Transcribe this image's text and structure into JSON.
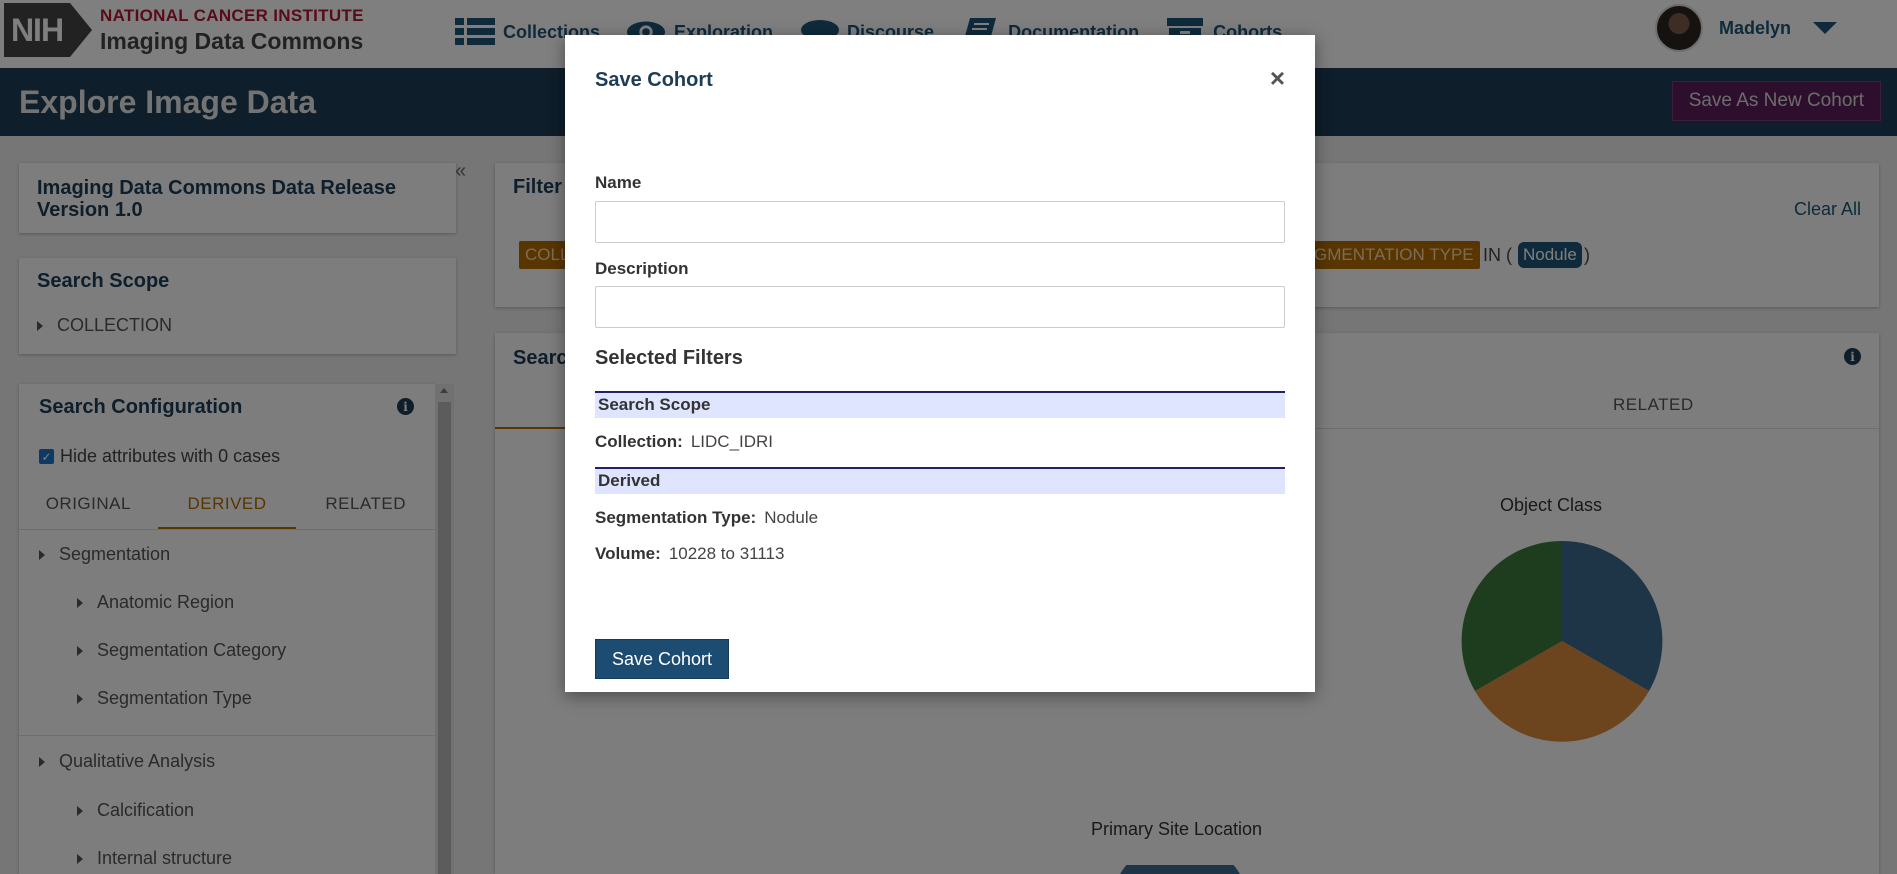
{
  "header": {
    "logo_mark": "NIH",
    "logo_subtitle": "NATIONAL CANCER INSTITUTE",
    "logo_title": "Imaging Data Commons",
    "nav": [
      {
        "label": "Collections",
        "icon": "list-icon"
      },
      {
        "label": "Exploration",
        "icon": "eye-icon"
      },
      {
        "label": "Discourse",
        "icon": "chat-bubble-icon"
      },
      {
        "label": "Documentation",
        "icon": "book-icon"
      },
      {
        "label": "Cohorts",
        "icon": "archive-box-icon"
      }
    ],
    "user_name": "Madelyn"
  },
  "titlebar": {
    "title": "Explore Image Data",
    "save_new_label": "Save As New Cohort"
  },
  "sidebar": {
    "release_title": "Imaging Data Commons Data Release Version 1.0",
    "scope_title": "Search Scope",
    "scope_item": "COLLECTION",
    "config_title": "Search Configuration",
    "hide_zero_label": "Hide attributes with 0 cases",
    "hide_zero_checked": true,
    "tabs": [
      "ORIGINAL",
      "DERIVED",
      "RELATED"
    ],
    "active_tab": "DERIVED",
    "tree": [
      {
        "label": "Segmentation",
        "level": 0
      },
      {
        "label": "Anatomic Region",
        "level": 1
      },
      {
        "label": "Segmentation Category",
        "level": 1
      },
      {
        "label": "Segmentation Type",
        "level": 1
      },
      {
        "label": "Qualitative Analysis",
        "level": 0
      },
      {
        "label": "Calcification",
        "level": 1
      },
      {
        "label": "Internal structure",
        "level": 1
      }
    ]
  },
  "filter": {
    "title_visible": "Filter",
    "chip_left": "COLL",
    "chip_right": "GMENTATION TYPE",
    "in_text": "IN (",
    "value_chip": "Nodule",
    "close_paren": ")",
    "clear_all": "Clear All"
  },
  "charts": {
    "title_visible": "Searc",
    "tab_related": "RELATED",
    "object_class_label": "Object Class",
    "primary_site_label": "Primary Site Location",
    "colors": {
      "blue": "#3b6a8f",
      "orange": "#d98a3d",
      "green": "#3d7a3d"
    }
  },
  "modal": {
    "title": "Save Cohort",
    "close_glyph": "×",
    "name_label": "Name",
    "name_value": "",
    "description_label": "Description",
    "description_value": "",
    "selected_filters_title": "Selected Filters",
    "groups": [
      {
        "name": "Search Scope",
        "items": [
          {
            "key": "Collection:",
            "value": "LIDC_IDRI"
          }
        ]
      },
      {
        "name": "Derived",
        "items": [
          {
            "key": "Segmentation Type:",
            "value": "Nodule"
          },
          {
            "key": "Volume:",
            "value": "10228 to 31113"
          }
        ]
      }
    ],
    "save_label": "Save Cohort"
  }
}
